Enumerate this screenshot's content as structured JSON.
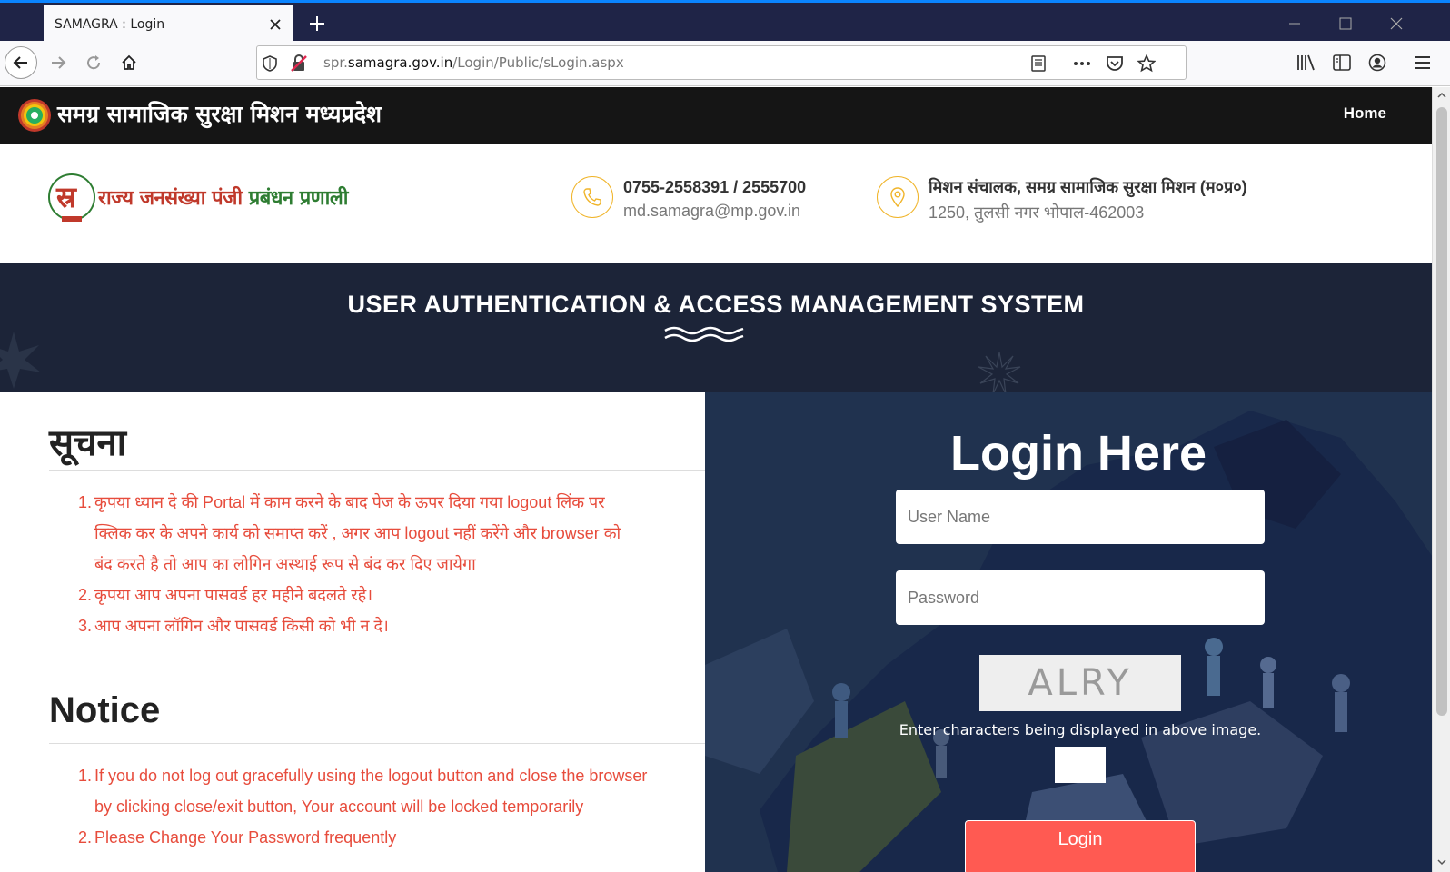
{
  "browser": {
    "tab_title": "SAMAGRA : Login",
    "url_prefix": "spr.",
    "url_host": "samagra.gov.in",
    "url_path": "/Login/Public/sLogin.aspx"
  },
  "site": {
    "title": "समग्र सामाजिक सुरक्षा मिशन मध्यप्रदेश",
    "nav_home": "Home"
  },
  "header": {
    "logo_text_red": "राज्य जनसंख्या पंजी ",
    "logo_text_green": "प्रबंधन प्रणाली",
    "phone": "0755-2558391 / 2555700",
    "email": "md.samagra@mp.gov.in",
    "office": "मिशन संचालक, समग्र सामाजिक सुरक्षा मिशन (म०प्र०)",
    "address": "1250, तुलसी नगर भोपाल-462003"
  },
  "banner": {
    "title": "USER AUTHENTICATION & ACCESS MANAGEMENT SYSTEM"
  },
  "suchna": {
    "heading": "सूचना",
    "items": [
      {
        "num": "1.",
        "lines": [
          "कृपया ध्यान दे की Portal में काम करने के बाद पेज के ऊपर दिया गया logout लिंक पर",
          "क्लिक कर के अपने कार्य को समाप्त करें , अगर आप logout नहीं करेंगे और browser को",
          "बंद करते है तो आप का लोगिन अस्थाई रूप से बंद कर दिए जायेगा"
        ]
      },
      {
        "num": "2.",
        "lines": [
          "कृपया आप अपना पासवर्ड हर महीने बदलते रहे।"
        ]
      },
      {
        "num": "3.",
        "lines": [
          "आप अपना लॉगिन और पासवर्ड किसी को भी न दे।"
        ]
      }
    ]
  },
  "notice": {
    "heading": "Notice",
    "items": [
      {
        "num": "1.",
        "lines": [
          "If you do not log out gracefully using the logout button and close the browser",
          "by clicking close/exit button, Your account will be locked temporarily"
        ]
      },
      {
        "num": "2.",
        "lines": [
          "Please Change Your Password frequently"
        ]
      }
    ]
  },
  "login": {
    "title": "Login Here",
    "username_placeholder": "User Name",
    "password_placeholder": "Password",
    "captcha_text": "ALRY",
    "captcha_hint": "Enter characters being displayed in above image.",
    "button": "Login"
  },
  "colors": {
    "topnav": "#151515",
    "banner": "#1c2438",
    "notice_text": "#e74c3c",
    "login_button": "#ff5a52",
    "contact_icon": "#f0b429"
  }
}
